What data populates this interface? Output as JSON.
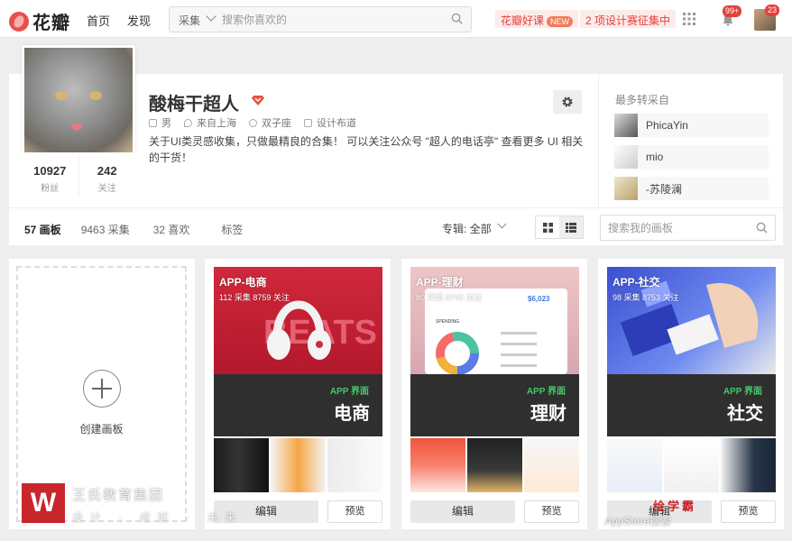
{
  "header": {
    "logo_text": "花瓣",
    "nav": [
      "首页",
      "发现"
    ],
    "search_category": "采集",
    "search_placeholder": "搜索你喜欢的",
    "promo_1": "花瓣好课",
    "promo_1_badge": "NEW",
    "promo_2": "2 项设计赛征集中",
    "notification_count": "99+",
    "avatar_count": "23"
  },
  "profile": {
    "name": "酸梅干超人",
    "gender": "男",
    "location": "来自上海",
    "zodiac": "双子座",
    "occupation": "设计布道",
    "bio": "关于UI类灵感收集，只做最精良的合集！ 可以关注公众号 \"超人的电话亭\" 查看更多 UI 相关的干货！",
    "followers": "10927",
    "followers_label": "粉丝",
    "following": "242",
    "following_label": "关注"
  },
  "repin_from": {
    "title": "最多转采自",
    "users": [
      "PhicaYin",
      "mio",
      "-苏陵澜"
    ]
  },
  "tabs": [
    "57 画板",
    "9463 采集",
    "32 喜欢",
    "标签"
  ],
  "album_filter": "专辑: 全部",
  "board_search_placeholder": "搜索我的画板",
  "create_board_label": "创建画板",
  "boards": [
    {
      "title": "APP-电商",
      "stats": "112 采集  8759 关注",
      "tag": "APP 界面",
      "big": "电商",
      "edit": "编辑",
      "preview": "预览"
    },
    {
      "title": "APP-理财",
      "stats": "80 采集  8740 关注",
      "tag": "APP 界面",
      "big": "理财",
      "edit": "编辑",
      "preview": "预览"
    },
    {
      "title": "APP-社交",
      "stats": "98 采集  8753 关注",
      "tag": "APP 界面",
      "big": "社交",
      "edit": "编辑",
      "preview": "预览"
    }
  ],
  "colors": {
    "brand": "#e3403c",
    "accent_green": "#43c96a"
  },
  "watermark": {
    "logo": "W",
    "line1": "王氏教育集团",
    "line2": "设计 · 成就 · 未来",
    "line3": "绘学霸",
    "line4": "AppStore搜索"
  }
}
